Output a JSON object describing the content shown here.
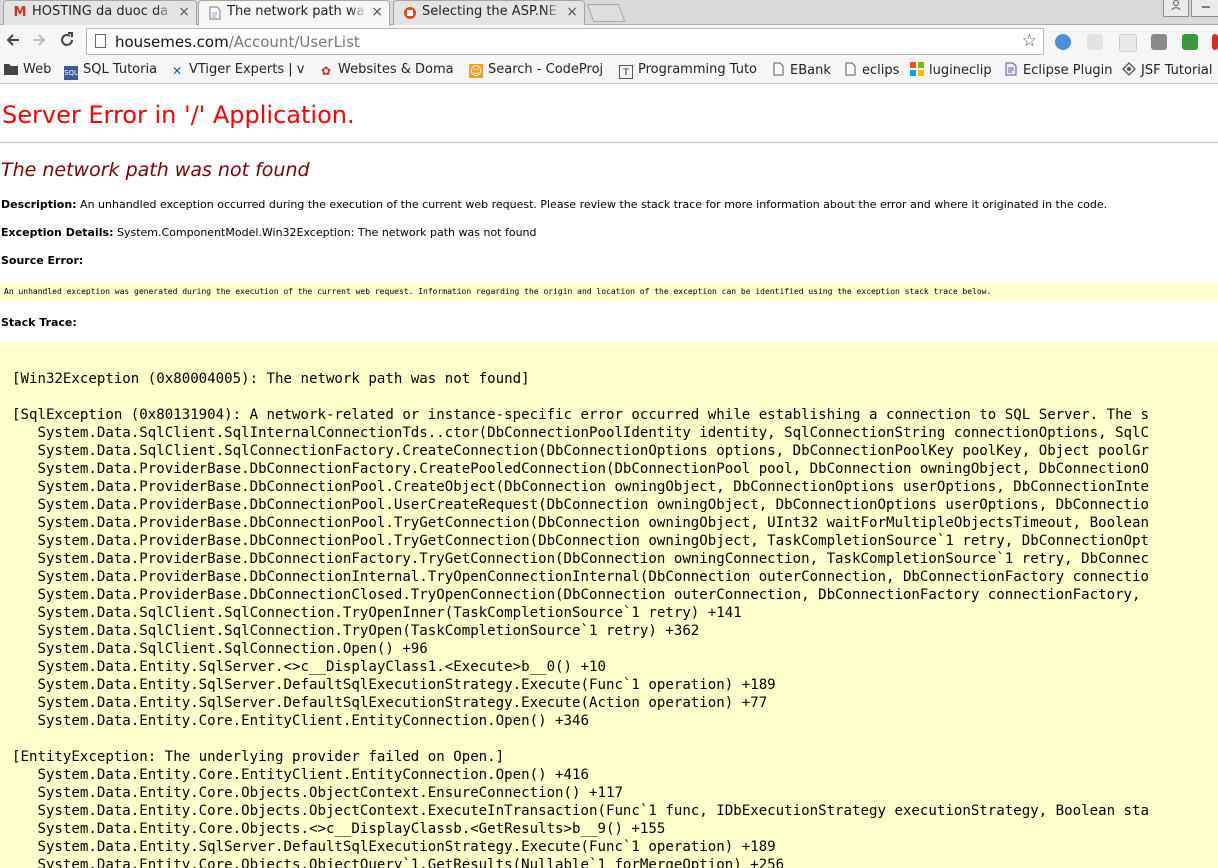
{
  "browser": {
    "tabs": [
      {
        "title": "HOSTING da duoc da",
        "favicon": "gmail-icon",
        "active": false
      },
      {
        "title": "The network path wa",
        "favicon": "page-icon",
        "active": true
      },
      {
        "title": "Selecting the ASP.NE",
        "favicon": "codeproject-icon",
        "active": false
      }
    ],
    "close_glyph": "×",
    "address": {
      "domain": "housemes.com",
      "path": "/Account/UserList"
    },
    "bookmarks": [
      {
        "label": "Web",
        "icon": "folder-icon"
      },
      {
        "label": "SQL Tutoria",
        "icon": "sql-icon"
      },
      {
        "label": "VTiger Experts | v",
        "icon": "vtiger-icon"
      },
      {
        "label": "Websites & Doma",
        "icon": "websites-icon"
      },
      {
        "label": "Search - CodeProj",
        "icon": "codeproject-icon"
      },
      {
        "label": "Programming Tuto",
        "icon": "tutorial-icon"
      },
      {
        "label": "EBank",
        "icon": "page-icon"
      },
      {
        "label": "eclips",
        "icon": "page-icon"
      },
      {
        "label": "lugineclip",
        "icon": "windows-icon"
      },
      {
        "label": "Eclipse Plugin",
        "icon": "eclipse-icon"
      },
      {
        "label": "JSF Tutorial",
        "icon": "jsf-icon"
      }
    ],
    "colors": {
      "tab_bar": "#d9d9d9",
      "toolbar": "#f6f6f6"
    }
  },
  "error_page": {
    "heading": "Server Error in '/' Application.",
    "subheading": "The network path was not found",
    "description_label": "Description:",
    "description_text": "An unhandled exception occurred during the execution of the current web request. Please review the stack trace for more information about the error and where it originated in the code.",
    "exception_label": "Exception Details:",
    "exception_text": "System.ComponentModel.Win32Exception: The network path was not found",
    "source_error_label": "Source Error:",
    "source_error_text": "An unhandled exception was generated during the execution of the current web request. Information regarding the origin and location of the exception can be identified using the exception stack trace below.",
    "stack_trace_label": "Stack Trace:",
    "stack_trace": "[Win32Exception (0x80004005): The network path was not found]\n\n[SqlException (0x80131904): A network-related or instance-specific error occurred while establishing a connection to SQL Server. The s\n   System.Data.SqlClient.SqlInternalConnectionTds..ctor(DbConnectionPoolIdentity identity, SqlConnectionString connectionOptions, SqlC\n   System.Data.SqlClient.SqlConnectionFactory.CreateConnection(DbConnectionOptions options, DbConnectionPoolKey poolKey, Object poolGr\n   System.Data.ProviderBase.DbConnectionFactory.CreatePooledConnection(DbConnectionPool pool, DbConnection owningObject, DbConnectionO\n   System.Data.ProviderBase.DbConnectionPool.CreateObject(DbConnection owningObject, DbConnectionOptions userOptions, DbConnectionInte\n   System.Data.ProviderBase.DbConnectionPool.UserCreateRequest(DbConnection owningObject, DbConnectionOptions userOptions, DbConnectio\n   System.Data.ProviderBase.DbConnectionPool.TryGetConnection(DbConnection owningObject, UInt32 waitForMultipleObjectsTimeout, Boolean\n   System.Data.ProviderBase.DbConnectionPool.TryGetConnection(DbConnection owningObject, TaskCompletionSource`1 retry, DbConnectionOpt\n   System.Data.ProviderBase.DbConnectionFactory.TryGetConnection(DbConnection owningConnection, TaskCompletionSource`1 retry, DbConnec\n   System.Data.ProviderBase.DbConnectionInternal.TryOpenConnectionInternal(DbConnection outerConnection, DbConnectionFactory connectio\n   System.Data.ProviderBase.DbConnectionClosed.TryOpenConnection(DbConnection outerConnection, DbConnectionFactory connectionFactory,\n   System.Data.SqlClient.SqlConnection.TryOpenInner(TaskCompletionSource`1 retry) +141\n   System.Data.SqlClient.SqlConnection.TryOpen(TaskCompletionSource`1 retry) +362\n   System.Data.SqlClient.SqlConnection.Open() +96\n   System.Data.Entity.SqlServer.<>c__DisplayClass1.<Execute>b__0() +10\n   System.Data.Entity.SqlServer.DefaultSqlExecutionStrategy.Execute(Func`1 operation) +189\n   System.Data.Entity.SqlServer.DefaultSqlExecutionStrategy.Execute(Action operation) +77\n   System.Data.Entity.Core.EntityClient.EntityConnection.Open() +346\n\n[EntityException: The underlying provider failed on Open.]\n   System.Data.Entity.Core.EntityClient.EntityConnection.Open() +416\n   System.Data.Entity.Core.Objects.ObjectContext.EnsureConnection() +117\n   System.Data.Entity.Core.Objects.ObjectContext.ExecuteInTransaction(Func`1 func, IDbExecutionStrategy executionStrategy, Boolean sta\n   System.Data.Entity.Core.Objects.<>c__DisplayClassb.<GetResults>b__9() +155\n   System.Data.Entity.SqlServer.DefaultSqlExecutionStrategy.Execute(Func`1 operation) +189\n   System.Data.Entity.Core.Objects.ObjectQuery`1.GetResults(Nullable`1 forMergeOption) +256",
    "colors": {
      "heading": "#ff0000",
      "subheading": "#800000",
      "highlight_bg": "#ffffcc"
    }
  }
}
